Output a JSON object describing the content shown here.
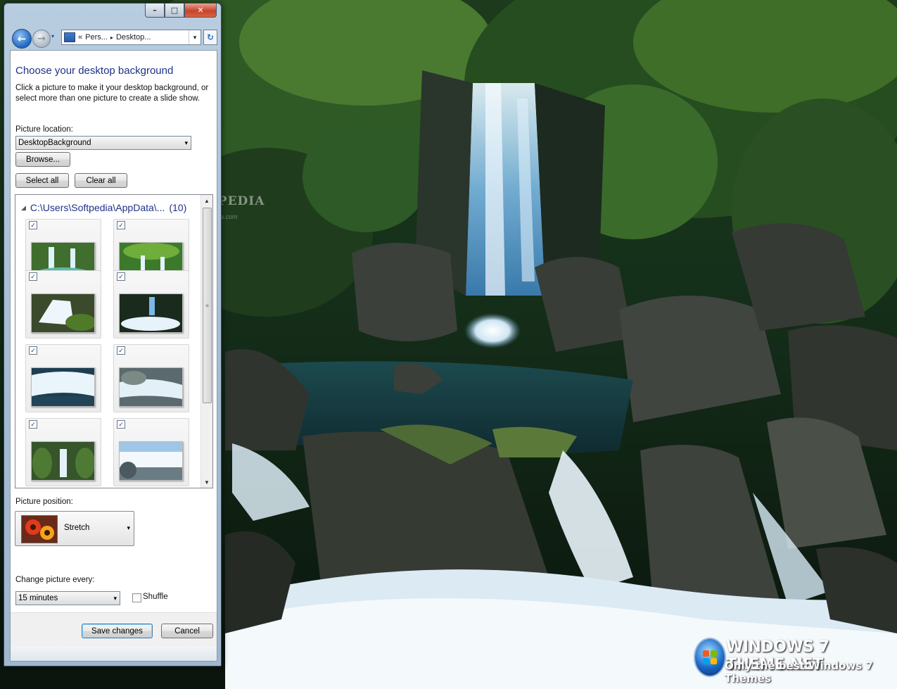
{
  "window": {
    "address_crumbs": [
      "Pers...",
      "Desktop..."
    ],
    "address_sep": "«",
    "crumb_sep": "▸"
  },
  "content": {
    "heading": "Choose your desktop background",
    "description": "Click a picture to make it your desktop background, or select more than one picture to create a slide show.",
    "picture_location_label": "Picture location:",
    "picture_location_value": "DesktopBackground",
    "browse_label": "Browse...",
    "select_all_label": "Select all",
    "clear_all_label": "Clear all",
    "group_path": "C:\\Users\\Softpedia\\AppData\\...",
    "group_count": "(10)",
    "thumbnails": [
      {
        "checked": true,
        "scene": "twin-falls"
      },
      {
        "checked": true,
        "scene": "green-falls"
      },
      {
        "checked": true,
        "scene": "wide-falls"
      },
      {
        "checked": true,
        "scene": "dark-falls"
      },
      {
        "checked": true,
        "scene": "cascade-blue"
      },
      {
        "checked": true,
        "scene": "cascade-rocks"
      },
      {
        "checked": true,
        "scene": "forest-falls"
      },
      {
        "checked": true,
        "scene": "big-falls"
      }
    ],
    "picture_position_label": "Picture position:",
    "picture_position_value": "Stretch",
    "change_every_label": "Change picture every:",
    "change_every_value": "15 minutes",
    "shuffle_label": "Shuffle",
    "shuffle_checked": false,
    "save_label": "Save changes",
    "cancel_label": "Cancel"
  },
  "desktop": {
    "watermark": "SOFTPEDIA",
    "watermark_url": "www.softpedia.com",
    "brand_title": "WINDOWS 7 THEME.NET",
    "brand_tagline": "Only the best Windows 7 Themes"
  },
  "icons": {
    "back": "←",
    "forward": "→",
    "dropdown": "▾",
    "refresh": "↻",
    "minimize": "–",
    "maximize": "□",
    "close": "✕",
    "check": "✓",
    "collapse": "◢",
    "scroll_up": "▲",
    "scroll_down": "▼",
    "grip": "≡"
  },
  "colors": {
    "heading_blue": "#1e3287",
    "window_frame": "#a3bbd2",
    "close_red": "#c7442b"
  }
}
